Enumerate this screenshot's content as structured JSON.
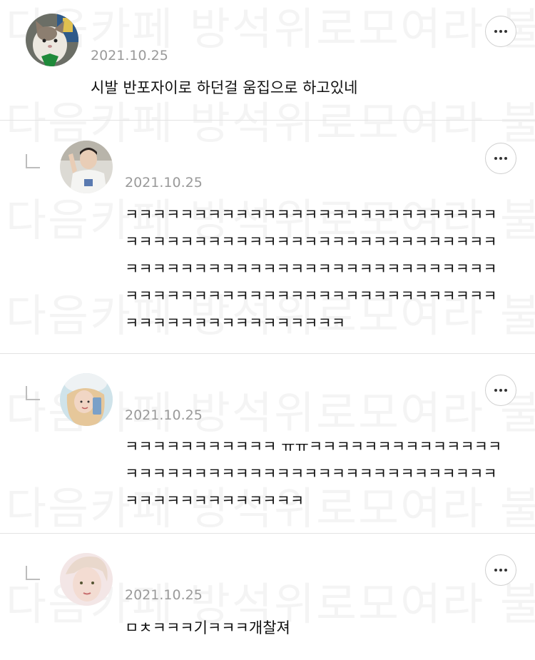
{
  "watermark_text": "다음카페 방석위로모여라 불펌금지",
  "comments": [
    {
      "avatar": "avatar-cat",
      "date": "2021.10.25",
      "text": "시발 반포자이로 하던걸 움집으로 하고있네",
      "is_reply": false
    },
    {
      "avatar": "avatar-person-1",
      "date": "2021.10.25",
      "text": "ㅋㅋㅋㅋㅋㅋㅋㅋㅋㅋㅋㅋㅋㅋㅋㅋㅋㅋㅋㅋㅋㅋㅋㅋㅋㅋㅋㅋㅋㅋㅋㅋㅋㅋㅋㅋㅋㅋㅋㅋㅋㅋㅋㅋㅋㅋㅋㅋㅋㅋㅋㅋㅋㅋㅋㅋㅋㅋㅋㅋㅋㅋㅋㅋㅋㅋㅋㅋㅋㅋㅋㅋㅋㅋㅋㅋㅋㅋㅋㅋㅋㅋㅋㅋㅋㅋㅋㅋㅋㅋㅋㅋㅋㅋㅋㅋㅋㅋㅋㅋㅋㅋㅋㅋㅋㅋㅋㅋㅋㅋㅋㅋㅋㅋㅋㅋㅋㅋㅋㅋㅋㅋㅋㅋ",
      "is_reply": true
    },
    {
      "avatar": "avatar-person-2",
      "date": "2021.10.25",
      "text": "ㅋㅋㅋㅋㅋㅋㅋㅋㅋㅋㅋ ㅠㅠㅋㅋㅋㅋㅋㅋㅋㅋㅋㅋㅋㅋㅋㅋㅋㅋㅋㅋㅋㅋㅋㅋㅋㅋㅋㅋㅋㅋㅋㅋㅋㅋㅋㅋㅋㅋㅋㅋㅋㅋㅋㅋㅋㅋㅋㅋㅋㅋㅋㅋㅋㅋㅋㅋ",
      "is_reply": true
    },
    {
      "avatar": "avatar-person-3",
      "date": "2021.10.25",
      "text": "ㅁㅊㅋㅋㅋ기ㅋㅋㅋ개찰져",
      "is_reply": true
    }
  ]
}
